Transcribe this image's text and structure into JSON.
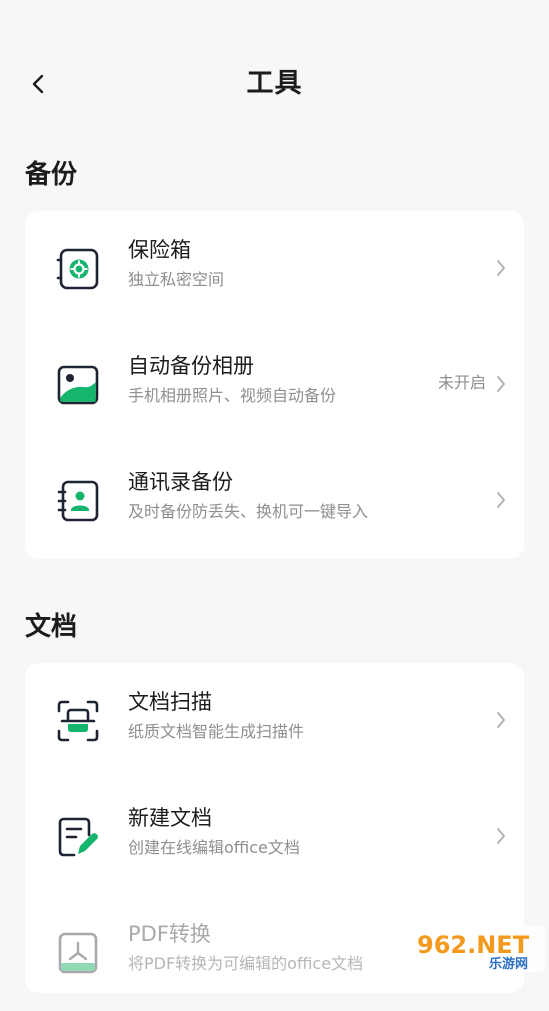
{
  "header": {
    "title": "工具",
    "back_icon": "chevron-left-icon"
  },
  "sections": [
    {
      "title": "备份",
      "items": [
        {
          "title": "保险箱",
          "subtitle": "独立私密空间",
          "icon": "safe-icon",
          "status": ""
        },
        {
          "title": "自动备份相册",
          "subtitle": "手机相册照片、视频自动备份",
          "icon": "photo-album-icon",
          "status": "未开启"
        },
        {
          "title": "通讯录备份",
          "subtitle": "及时备份防丢失、换机可一键导入",
          "icon": "contacts-icon",
          "status": ""
        }
      ]
    },
    {
      "title": "文档",
      "items": [
        {
          "title": "文档扫描",
          "subtitle": "纸质文档智能生成扫描件",
          "icon": "scan-icon",
          "status": ""
        },
        {
          "title": "新建文档",
          "subtitle": "创建在线编辑office文档",
          "icon": "new-document-icon",
          "status": ""
        },
        {
          "title": "PDF转换",
          "subtitle": "将PDF转换为可编辑的office文档",
          "icon": "pdf-convert-icon",
          "status": ""
        }
      ]
    }
  ],
  "watermark": {
    "brand": "962.NET",
    "sub": "乐游网"
  },
  "colors": {
    "accent": "#16b56e",
    "icon_stroke": "#1e2433",
    "background": "#f6f7f9",
    "card": "#ffffff",
    "secondary_text": "#8e8e93"
  }
}
